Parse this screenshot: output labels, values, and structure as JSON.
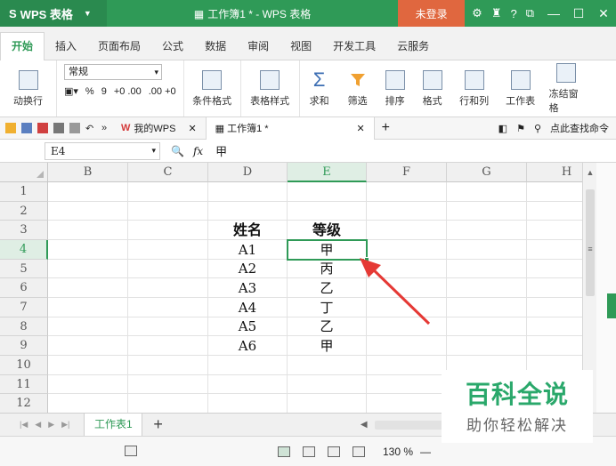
{
  "titlebar": {
    "app_name": "WPS 表格",
    "window_title": "工作簿1 * - WPS 表格",
    "login_label": "未登录",
    "help_label": "?"
  },
  "menu": {
    "tabs": [
      "开始",
      "插入",
      "页面布局",
      "公式",
      "数据",
      "审阅",
      "视图",
      "开发工具",
      "云服务"
    ],
    "active": "开始"
  },
  "ribbon": {
    "wrap_label": "动换行",
    "number_format": "常规",
    "percent_label": "%",
    "comma_label": "9",
    "inc_decimal": "+0 .00",
    "dec_decimal": ".00 +0",
    "conditional_format": "条件格式",
    "table_style": "表格样式",
    "sum": "求和",
    "filter": "筛选",
    "sort": "排序",
    "format": "格式",
    "row_col": "行和列",
    "worksheet": "工作表",
    "freeze": "冻结窗格"
  },
  "quickbar": {
    "my_wps": "我的WPS",
    "doc_tab": "工作簿1 *",
    "search": "点此查找命令"
  },
  "formula_bar": {
    "cell_ref": "E4",
    "fx": "fx",
    "value": "甲"
  },
  "grid": {
    "columns": [
      "B",
      "C",
      "D",
      "E",
      "F",
      "G",
      "H"
    ],
    "rows": [
      "1",
      "2",
      "3",
      "4",
      "5",
      "6",
      "7",
      "8",
      "9",
      "10",
      "11",
      "12"
    ],
    "header_name": "姓名",
    "header_grade": "等级",
    "records": [
      {
        "name": "A1",
        "grade": "甲"
      },
      {
        "name": "A2",
        "grade": "丙"
      },
      {
        "name": "A3",
        "grade": "乙"
      },
      {
        "name": "A4",
        "grade": "丁"
      },
      {
        "name": "A5",
        "grade": "乙"
      },
      {
        "name": "A6",
        "grade": "甲"
      }
    ]
  },
  "sheets": {
    "tab": "工作表1",
    "add": "+"
  },
  "status": {
    "zoom": "130 %"
  },
  "watermark": {
    "title": "百科全说",
    "subtitle": "助你轻松解决"
  },
  "colors": {
    "accent": "#2f9a57",
    "login": "#e0673f",
    "arrow": "#e53935"
  }
}
